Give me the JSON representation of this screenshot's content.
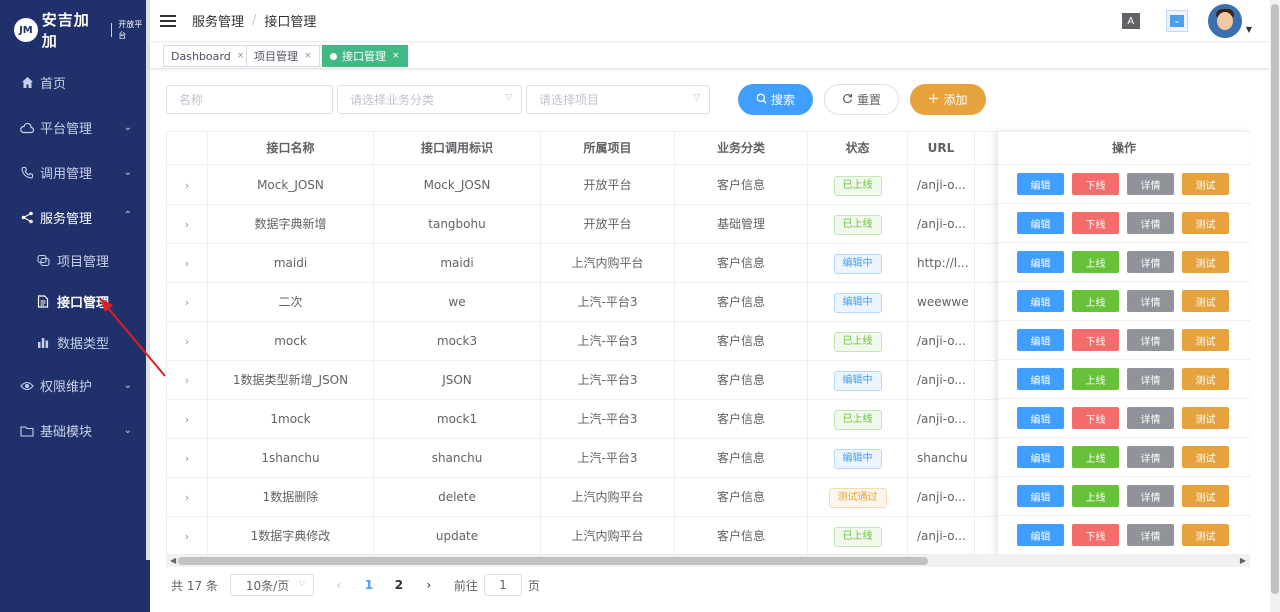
{
  "logo": {
    "mark": "JM",
    "text": "安吉加加",
    "sub": "开放平台"
  },
  "sidebar": {
    "items": [
      {
        "label": "首页",
        "icon": "home-icon"
      },
      {
        "label": "平台管理",
        "icon": "cloud-icon"
      },
      {
        "label": "调用管理",
        "icon": "phone-icon"
      },
      {
        "label": "服务管理",
        "icon": "share-icon"
      },
      {
        "label": "权限维护",
        "icon": "eye-icon"
      },
      {
        "label": "基础模块",
        "icon": "folder-icon"
      }
    ],
    "sub_items": [
      {
        "label": "项目管理",
        "icon": "layers-icon"
      },
      {
        "label": "接口管理",
        "icon": "document-icon"
      },
      {
        "label": "数据类型",
        "icon": "bar-chart-icon"
      }
    ]
  },
  "header": {
    "breadcrumb": [
      "服务管理",
      "接口管理"
    ],
    "translate_label": "A",
    "screen_label": "⌄"
  },
  "tags": [
    {
      "label": "Dashboard",
      "close": "×"
    },
    {
      "label": "项目管理",
      "close": "×"
    },
    {
      "label": "接口管理",
      "close": "×"
    }
  ],
  "filters": {
    "name_placeholder": "名称",
    "category_placeholder": "请选择业务分类",
    "project_placeholder": "请选择项目",
    "search_label": "搜索",
    "reset_label": "重置",
    "add_label": "添加"
  },
  "table": {
    "columns": [
      "接口名称",
      "接口调用标识",
      "所属项目",
      "业务分类",
      "状态",
      "URL"
    ],
    "ops_header": "操作",
    "rows": [
      {
        "name": "Mock_JOSN",
        "code": "Mock_JOSN",
        "project": "开放平台",
        "category": "客户信息",
        "status": "已上线",
        "url": "/anji-o...",
        "toggle": "下线"
      },
      {
        "name": "数据字典新增",
        "code": "tangbohu",
        "project": "开放平台",
        "category": "基础管理",
        "status": "已上线",
        "url": "/anji-o...",
        "toggle": "下线"
      },
      {
        "name": "maidi",
        "code": "maidi",
        "project": "上汽内购平台",
        "category": "客户信息",
        "status": "编辑中",
        "url": "http://l...",
        "toggle": "上线"
      },
      {
        "name": "二次",
        "code": "we",
        "project": "上汽-平台3",
        "category": "客户信息",
        "status": "编辑中",
        "url": "weewwe",
        "toggle": "上线"
      },
      {
        "name": "mock",
        "code": "mock3",
        "project": "上汽-平台3",
        "category": "客户信息",
        "status": "已上线",
        "url": "/anji-o...",
        "toggle": "下线"
      },
      {
        "name": "1数据类型新增_JSON",
        "code": "JSON",
        "project": "上汽-平台3",
        "category": "客户信息",
        "status": "编辑中",
        "url": "/anji-o...",
        "toggle": "上线"
      },
      {
        "name": "1mock",
        "code": "mock1",
        "project": "上汽-平台3",
        "category": "客户信息",
        "status": "已上线",
        "url": "/anji-o...",
        "toggle": "下线"
      },
      {
        "name": "1shanchu",
        "code": "shanchu",
        "project": "上汽-平台3",
        "category": "客户信息",
        "status": "编辑中",
        "url": "shanchu",
        "toggle": "上线"
      },
      {
        "name": "1数据删除",
        "code": "delete",
        "project": "上汽内购平台",
        "category": "客户信息",
        "status": "测试通过",
        "url": "/anji-o...",
        "toggle": "上线"
      },
      {
        "name": "1数据字典修改",
        "code": "update",
        "project": "上汽内购平台",
        "category": "客户信息",
        "status": "已上线",
        "url": "/anji-o...",
        "toggle": "下线"
      }
    ],
    "op_labels": {
      "edit": "编辑",
      "detail": "详情",
      "test": "测试"
    }
  },
  "pagination": {
    "total": "共 17 条",
    "page_size": "10条/页",
    "pages": [
      "1",
      "2"
    ],
    "current": "1",
    "goto_label": "前往",
    "goto_value": "1",
    "page_unit": "页"
  },
  "colors": {
    "sidebar": "#20306a",
    "primary": "#409eff",
    "success": "#67c23a",
    "danger": "#f56c6c",
    "warning": "#e6a23c",
    "info": "#909399",
    "tag_active": "#42b983",
    "annotation": "#e02020"
  }
}
